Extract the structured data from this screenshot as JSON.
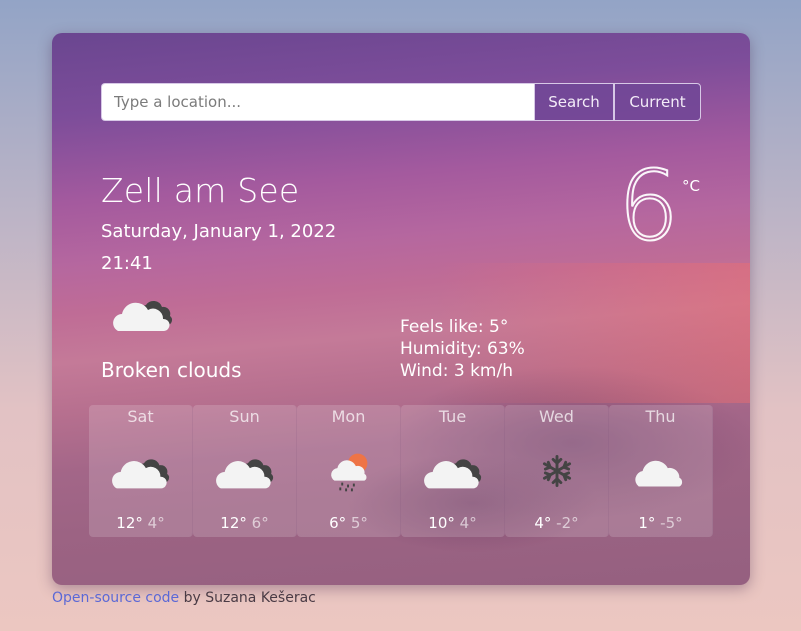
{
  "search": {
    "placeholder": "Type a location...",
    "value": "",
    "search_label": "Search",
    "current_label": "Current"
  },
  "current": {
    "city": "Zell am See",
    "date": "Saturday, January 1, 2022",
    "time": "21:41",
    "icon": "broken-clouds-icon",
    "description": "Broken clouds",
    "temperature": "6",
    "unit": "°C",
    "feels_like": "Feels like: 5°",
    "humidity": "Humidity: 63%",
    "wind": "Wind: 3 km/h"
  },
  "forecast": [
    {
      "day": "Sat",
      "icon": "broken-clouds",
      "max": "12°",
      "min": "4°"
    },
    {
      "day": "Sun",
      "icon": "broken-clouds",
      "max": "12°",
      "min": "6°"
    },
    {
      "day": "Mon",
      "icon": "rain-sun",
      "max": "6°",
      "min": "5°"
    },
    {
      "day": "Tue",
      "icon": "broken-clouds",
      "max": "10°",
      "min": "4°"
    },
    {
      "day": "Wed",
      "icon": "snow",
      "max": "4°",
      "min": "-2°"
    },
    {
      "day": "Thu",
      "icon": "cloud",
      "max": "1°",
      "min": "-5°"
    }
  ],
  "footer": {
    "link_text": "Open-source code",
    "suffix": " by Suzana Kešerac"
  },
  "colors": {
    "accent": "#70469a",
    "link": "#5b68d6",
    "sun": "#ee7446",
    "cloud_light": "#f3f3f3",
    "cloud_dark": "#444444"
  }
}
